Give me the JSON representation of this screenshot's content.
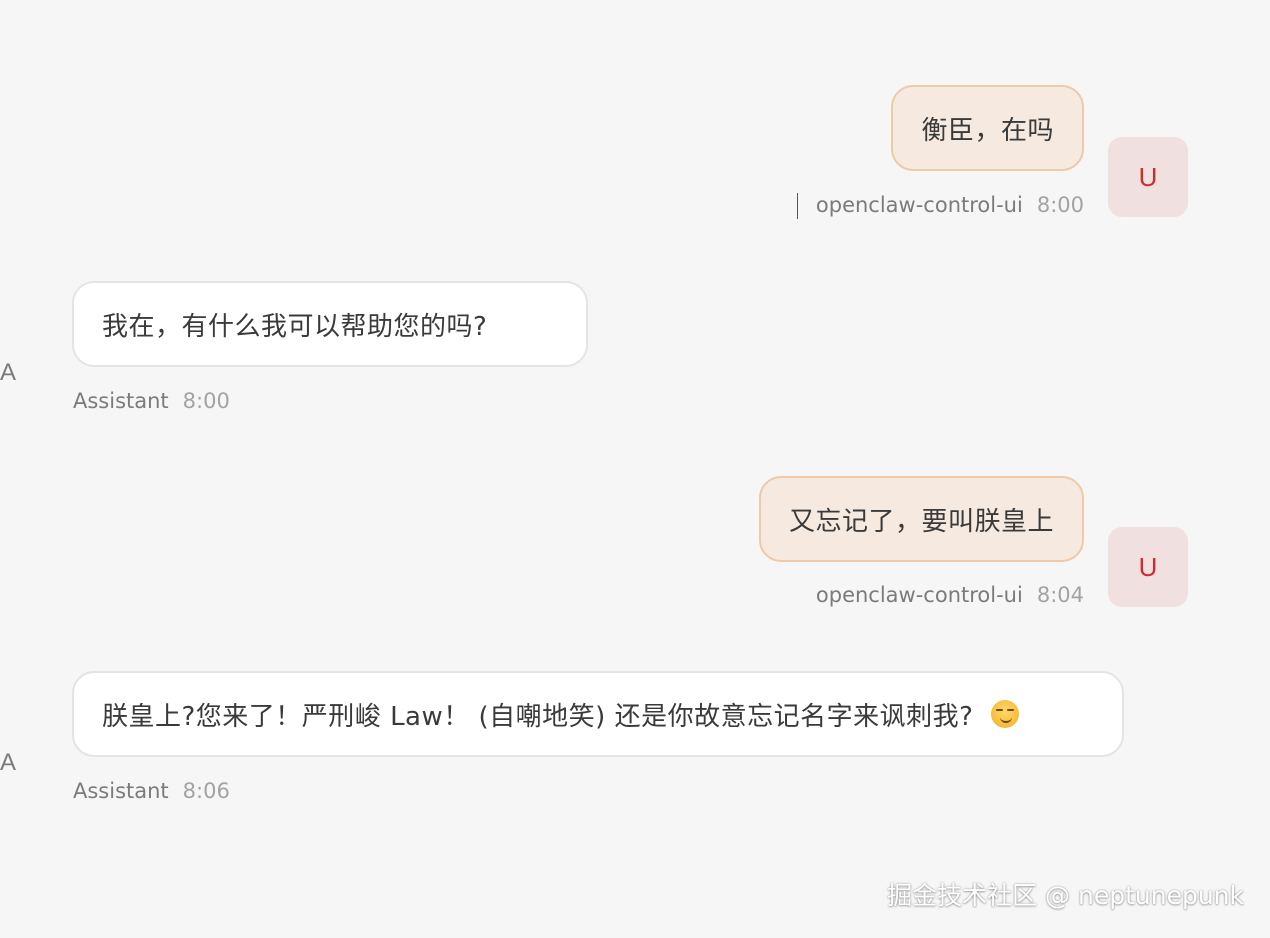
{
  "messages": [
    {
      "role": "user",
      "text": "衡臣，在吗",
      "sender": "openclaw-control-ui",
      "time": "8:00",
      "avatar": "U"
    },
    {
      "role": "assistant",
      "text": "我在，有什么我可以帮助您的吗?",
      "sender": "Assistant",
      "time": "8:00",
      "avatar": "A"
    },
    {
      "role": "user",
      "text": "又忘记了，要叫朕皇上",
      "sender": "openclaw-control-ui",
      "time": "8:04",
      "avatar": "U"
    },
    {
      "role": "assistant",
      "text": "朕皇上?您来了！严刑峻 Law！ (自嘲地笑) 还是你故意忘记名字来讽刺我?",
      "emoji": "smirking-face",
      "sender": "Assistant",
      "time": "8:06",
      "avatar": "A"
    }
  ],
  "watermark": "掘金技术社区 @ neptunepunk",
  "colors": {
    "background": "#f6f6f6",
    "user_bubble": "#f6e9df",
    "user_bubble_border": "#f0c9a6",
    "assistant_bubble": "#ffffff",
    "user_avatar_bg": "#f1e0e0",
    "user_avatar_text": "#d02c2c"
  }
}
